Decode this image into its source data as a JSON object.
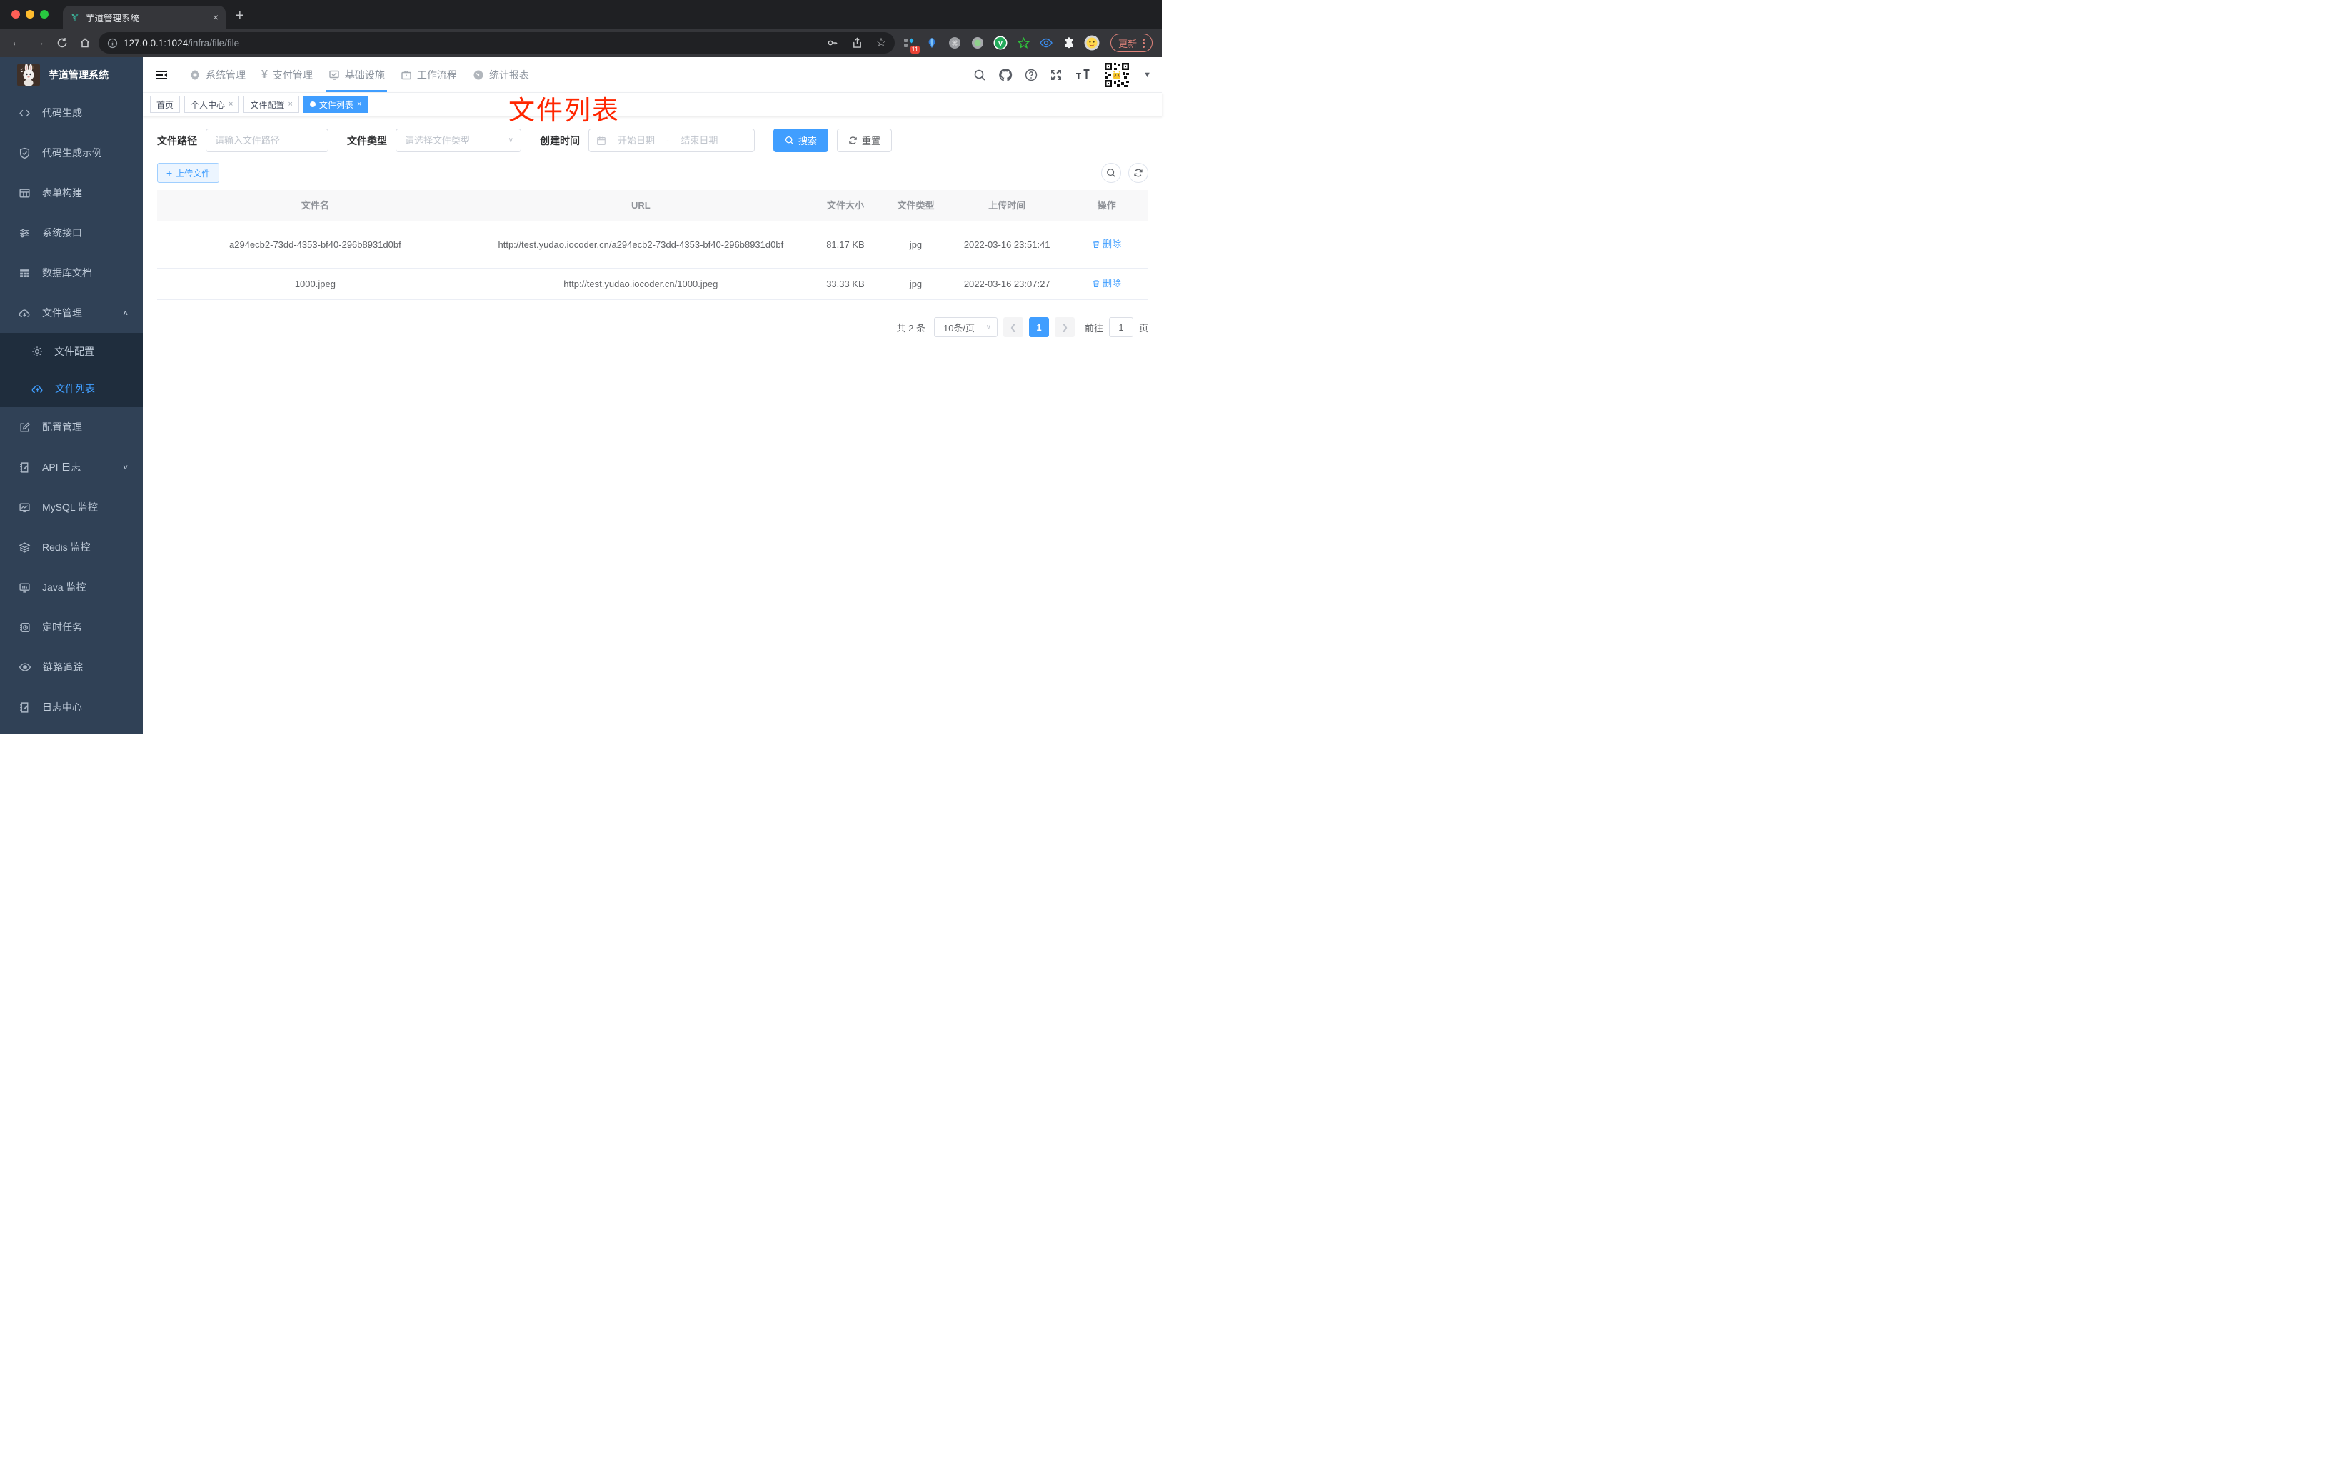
{
  "browser": {
    "tab_title": "芋道管理系统",
    "url_host": "127.0.0.1:1024",
    "url_path": "/infra/file/file",
    "extension_badge": "11",
    "update_label": "更新"
  },
  "icons": {
    "close": "×",
    "plus": "+",
    "newtab": "+",
    "back": "←",
    "forward": "→",
    "star": "☆",
    "caret_down": "▾",
    "caret_down_big": "▼",
    "chevron_up": "∧",
    "chevron_down": "∨",
    "chevron_left": "❮",
    "chevron_right": "❯",
    "date_sep": "-"
  },
  "sidebar": {
    "title": "芋道管理系统",
    "items": [
      {
        "label": "代码生成"
      },
      {
        "label": "代码生成示例"
      },
      {
        "label": "表单构建"
      },
      {
        "label": "系统接口"
      },
      {
        "label": "数据库文档"
      },
      {
        "label": "文件管理"
      },
      {
        "label": "文件配置"
      },
      {
        "label": "文件列表"
      },
      {
        "label": "配置管理"
      },
      {
        "label": "API 日志"
      },
      {
        "label": "MySQL 监控"
      },
      {
        "label": "Redis 监控"
      },
      {
        "label": "Java 监控"
      },
      {
        "label": "定时任务"
      },
      {
        "label": "链路追踪"
      },
      {
        "label": "日志中心"
      }
    ]
  },
  "navbar": {
    "menu": [
      {
        "label": "系统管理"
      },
      {
        "label": "支付管理"
      },
      {
        "label": "基础设施"
      },
      {
        "label": "工作流程"
      },
      {
        "label": "统计报表"
      }
    ]
  },
  "tags": [
    {
      "label": "首页"
    },
    {
      "label": "个人中心"
    },
    {
      "label": "文件配置"
    },
    {
      "label": "文件列表"
    }
  ],
  "annotation": "文件列表",
  "filters": {
    "path_label": "文件路径",
    "path_placeholder": "请输入文件路径",
    "type_label": "文件类型",
    "type_placeholder": "请选择文件类型",
    "time_label": "创建时间",
    "start_placeholder": "开始日期",
    "end_placeholder": "结束日期",
    "search_label": "搜索",
    "reset_label": "重置"
  },
  "toolbar": {
    "upload_label": "上传文件"
  },
  "table": {
    "headers": [
      "文件名",
      "URL",
      "文件大小",
      "文件类型",
      "上传时间",
      "操作"
    ],
    "delete_label": "删除",
    "rows": [
      {
        "name": "a294ecb2-73dd-4353-bf40-296b8931d0bf",
        "url": "http://test.yudao.iocoder.cn/a294ecb2-73dd-4353-bf40-296b8931d0bf",
        "size": "81.17 KB",
        "type": "jpg",
        "time": "2022-03-16 23:51:41"
      },
      {
        "name": "1000.jpeg",
        "url": "http://test.yudao.iocoder.cn/1000.jpeg",
        "size": "33.33 KB",
        "type": "jpg",
        "time": "2022-03-16 23:07:27"
      }
    ]
  },
  "pagination": {
    "total_text": "共 2 条",
    "page_size": "10条/页",
    "current_page": "1",
    "jump_prefix": "前往",
    "jump_value": "1",
    "jump_suffix": "页"
  }
}
